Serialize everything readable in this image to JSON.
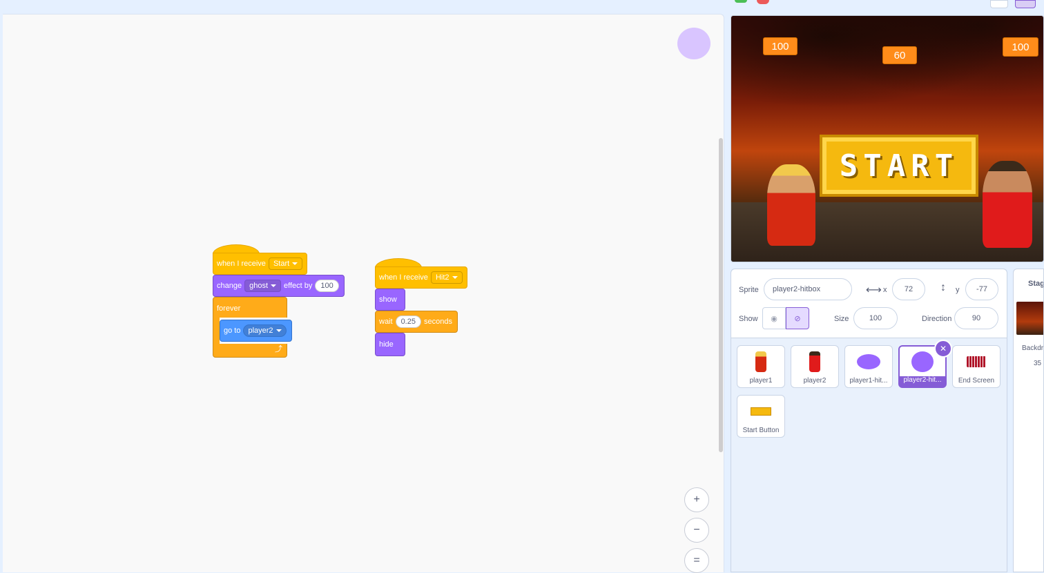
{
  "code": {
    "script1": {
      "hat_label": "when I receive",
      "hat_message": "Start",
      "change_label": "change",
      "effect_name": "ghost",
      "effect_by_label": "effect by",
      "effect_value": "100",
      "forever_label": "forever",
      "goto_label": "go to",
      "goto_target": "player2"
    },
    "script2": {
      "hat_label": "when I receive",
      "hat_message": "Hit2",
      "show_label": "show",
      "wait_label": "wait",
      "wait_value": "0.25",
      "seconds_label": "seconds",
      "hide_label": "hide"
    },
    "zoom": {
      "in": "+",
      "out": "−",
      "reset": "="
    }
  },
  "stage": {
    "score_left": "100",
    "score_timer": "60",
    "score_right": "100",
    "start_text": "START"
  },
  "sprite_info": {
    "sprite_label": "Sprite",
    "sprite_name": "player2-hitbox",
    "x_label": "x",
    "x_value": "72",
    "y_label": "y",
    "y_value": "-77",
    "show_label": "Show",
    "size_label": "Size",
    "size_value": "100",
    "direction_label": "Direction",
    "direction_value": "90"
  },
  "sprites": [
    {
      "name": "player1"
    },
    {
      "name": "player2"
    },
    {
      "name": "player1-hit..."
    },
    {
      "name": "player2-hit..."
    },
    {
      "name": "End Screen"
    },
    {
      "name": "Start Button"
    }
  ],
  "stage_panel": {
    "title": "Stag",
    "backdrops_label": "Backdr",
    "backdrops_count": "35"
  },
  "colors": {
    "events": "#ffbf00",
    "looks": "#9966ff",
    "motion": "#4c97ff",
    "control": "#ffab19",
    "selected": "#855cd6"
  }
}
